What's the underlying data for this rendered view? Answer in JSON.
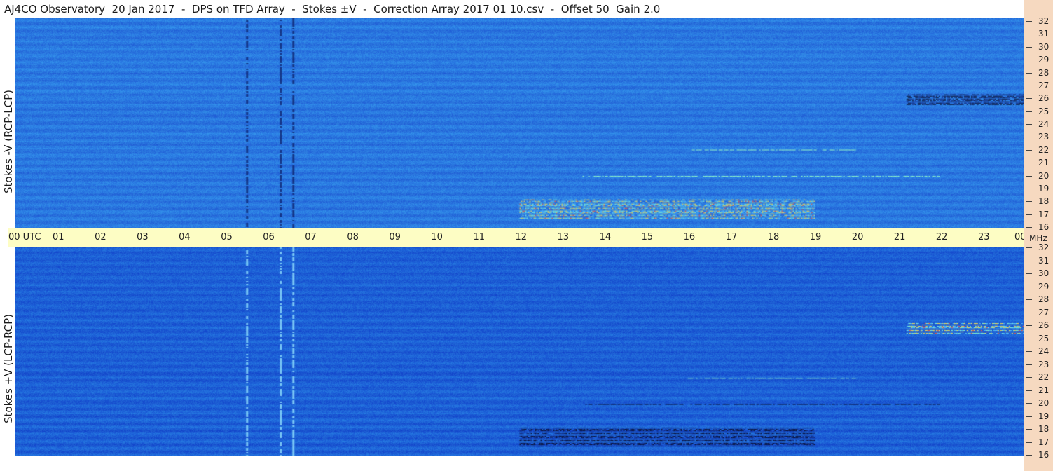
{
  "title": "AJ4CO Observatory  20 Jan 2017  -  DPS on TFD Array  -  Stokes ±V  -  Correction Array 2017 01 10.csv  -  Offset 50  Gain 2.0",
  "colors": {
    "background_top": "#2a78e0",
    "background_bottom": "#1d60d6",
    "utc_bar": "#fdfdc4",
    "right_strip": "#f6d9c0"
  },
  "chart_data": [
    {
      "type": "heatmap",
      "title": "",
      "ylabel": "Stokes -V (RCP-LCP)",
      "xlabel": "UTC",
      "x_ticks": [
        "00 UTC",
        "01",
        "02",
        "03",
        "04",
        "05",
        "06",
        "07",
        "08",
        "09",
        "10",
        "11",
        "12",
        "13",
        "14",
        "15",
        "16",
        "17",
        "18",
        "19",
        "20",
        "21",
        "22",
        "23",
        "00"
      ],
      "y_unit": "MHz",
      "y_ticks": [
        "16",
        "17",
        "18",
        "19",
        "20",
        "21",
        "22",
        "23",
        "24",
        "25",
        "26",
        "27",
        "28",
        "29",
        "30",
        "31",
        "32"
      ],
      "xlim": [
        0,
        24
      ],
      "ylim": [
        16,
        32
      ],
      "grid": false,
      "features": [
        {
          "kind": "broadband-spike",
          "utc": 5.5,
          "intensity": "low"
        },
        {
          "kind": "broadband-spike",
          "utc": 6.3,
          "intensity": "low"
        },
        {
          "kind": "broadband-spike",
          "utc": 6.6,
          "intensity": "low"
        },
        {
          "kind": "emission-band",
          "utc_start": 12.0,
          "utc_end": 19.0,
          "mhz_start": 16.8,
          "mhz_end": 18.2,
          "intensity": "high"
        },
        {
          "kind": "emission-line",
          "utc_start": 13.5,
          "utc_end": 22.0,
          "mhz": 20.0,
          "intensity": "medium"
        },
        {
          "kind": "emission-line",
          "utc_start": 16.0,
          "utc_end": 20.0,
          "mhz": 22.0,
          "intensity": "medium"
        },
        {
          "kind": "absorption-band",
          "utc_start": 21.2,
          "utc_end": 24.0,
          "mhz_start": 25.4,
          "mhz_end": 26.2,
          "intensity": "low"
        }
      ]
    },
    {
      "type": "heatmap",
      "title": "",
      "ylabel": "Stokes +V (LCP-RCP)",
      "xlabel": "UTC",
      "x_ticks": [
        "00 UTC",
        "01",
        "02",
        "03",
        "04",
        "05",
        "06",
        "07",
        "08",
        "09",
        "10",
        "11",
        "12",
        "13",
        "14",
        "15",
        "16",
        "17",
        "18",
        "19",
        "20",
        "21",
        "22",
        "23",
        "00"
      ],
      "y_unit": "MHz",
      "y_ticks": [
        "16",
        "17",
        "18",
        "19",
        "20",
        "21",
        "22",
        "23",
        "24",
        "25",
        "26",
        "27",
        "28",
        "29",
        "30",
        "31",
        "32"
      ],
      "xlim": [
        0,
        24
      ],
      "ylim": [
        16,
        32
      ],
      "grid": false,
      "features": [
        {
          "kind": "broadband-spike",
          "utc": 5.5,
          "intensity": "high"
        },
        {
          "kind": "broadband-spike",
          "utc": 6.3,
          "intensity": "high"
        },
        {
          "kind": "broadband-spike",
          "utc": 6.6,
          "intensity": "high"
        },
        {
          "kind": "absorption-band",
          "utc_start": 12.0,
          "utc_end": 19.0,
          "mhz_start": 16.8,
          "mhz_end": 18.2,
          "intensity": "low"
        },
        {
          "kind": "absorption-line",
          "utc_start": 13.5,
          "utc_end": 22.0,
          "mhz": 20.0,
          "intensity": "low"
        },
        {
          "kind": "emission-line",
          "utc_start": 16.0,
          "utc_end": 20.0,
          "mhz": 22.0,
          "intensity": "medium"
        },
        {
          "kind": "emission-band",
          "utc_start": 21.2,
          "utc_end": 24.0,
          "mhz_start": 25.4,
          "mhz_end": 26.2,
          "intensity": "high"
        }
      ]
    }
  ]
}
